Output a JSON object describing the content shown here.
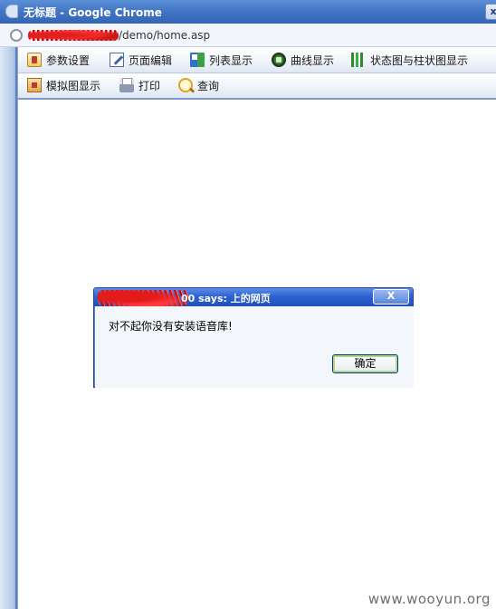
{
  "window": {
    "title": "无标题 - Google Chrome",
    "controls": "x"
  },
  "address_bar": {
    "url_visible": "/demo/home.asp"
  },
  "toolbar_rows": [
    [
      {
        "label": "参数设置",
        "icon": "settings-icon"
      },
      {
        "label": "页面编辑",
        "icon": "edit-icon"
      },
      {
        "label": "列表显示",
        "icon": "list-icon"
      },
      {
        "label": "曲线显示",
        "icon": "curve-icon"
      },
      {
        "label": "状态图与柱状图显示",
        "icon": "bar-chart-icon"
      }
    ],
    [
      {
        "label": "模拟图显示",
        "icon": "mock-icon"
      },
      {
        "label": "打印",
        "icon": "printer-icon"
      },
      {
        "label": "查询",
        "icon": "search-icon"
      }
    ]
  ],
  "dialog": {
    "title_visible": "00 says: 上的网页",
    "close_label": "X",
    "message": "对不起你没有安装语音库!",
    "ok_label": "确定"
  },
  "watermark": "www.wooyun.org",
  "colors": {
    "title_bar": "#3f72c1",
    "dialog_title": "#2e63cf",
    "redaction": "#e02020"
  }
}
